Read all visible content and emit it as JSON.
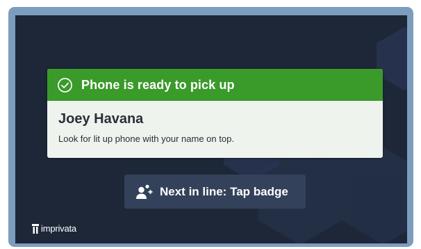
{
  "notification": {
    "title": "Phone is ready to pick up",
    "name": "Joey Havana",
    "message": "Look for lit up phone with your name on top.",
    "header_color": "#3a9a2a"
  },
  "action": {
    "label": "Next in line: Tap badge"
  },
  "brand": {
    "logo_text": "imprivata"
  },
  "icons": {
    "header": "check-circle-icon",
    "action": "add-user-icon",
    "logo": "imprivata-logo-icon"
  }
}
